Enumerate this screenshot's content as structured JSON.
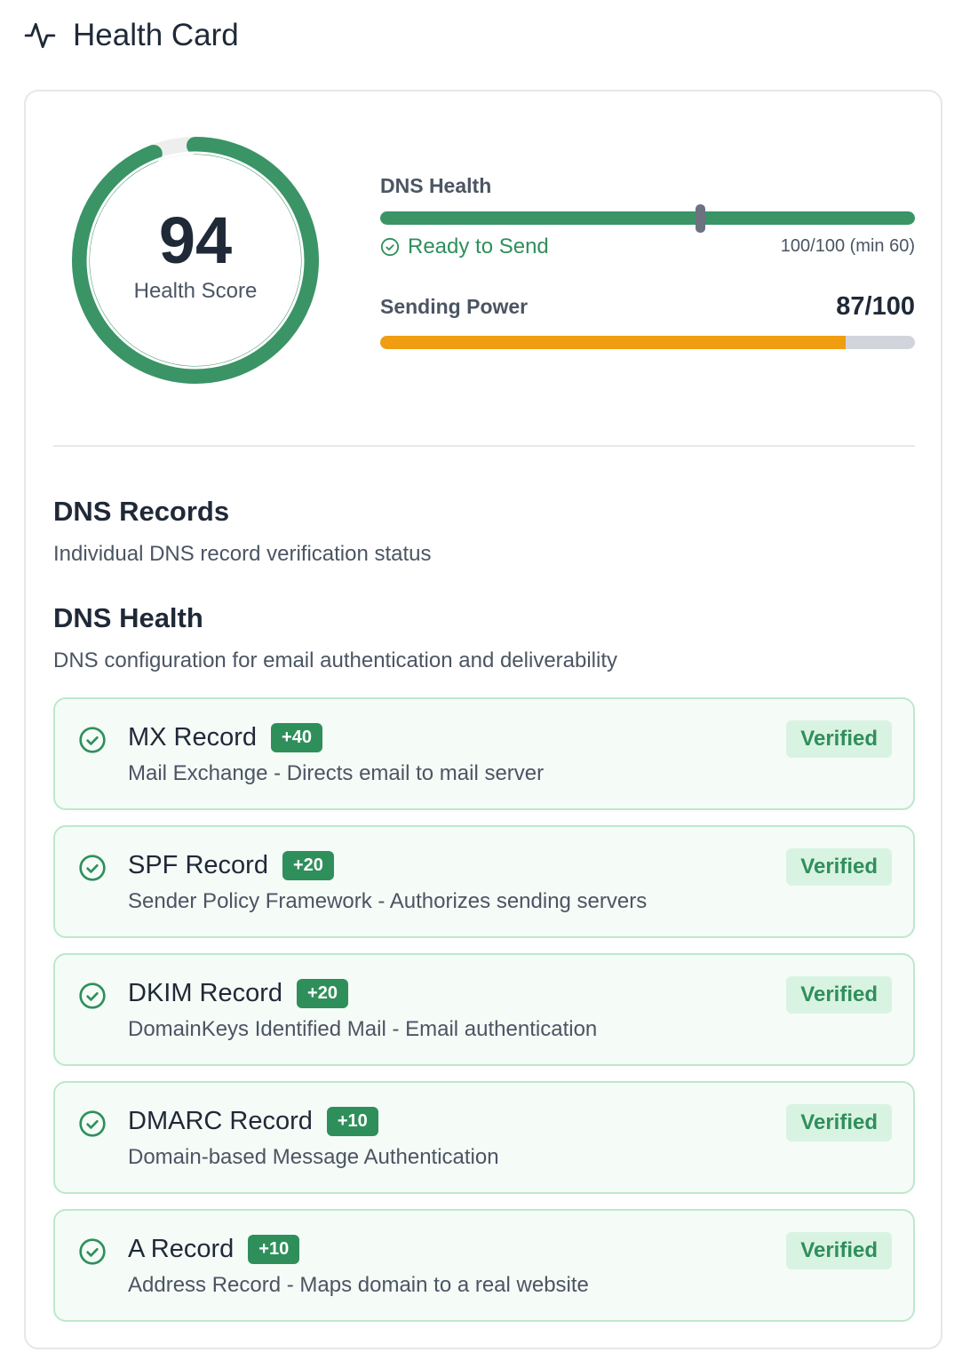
{
  "header": {
    "title": "Health Card",
    "icon": "activity-icon"
  },
  "score": {
    "value": "94",
    "label": "Health Score",
    "fraction": 0.94
  },
  "dns_health": {
    "label": "DNS Health",
    "value": 100,
    "max": 100,
    "min": 60,
    "status": "Ready to Send",
    "detail": "100/100 (min 60)"
  },
  "sending_power": {
    "label": "Sending Power",
    "value_text": "87/100",
    "value": 87,
    "max": 100
  },
  "dns_records": {
    "title": "DNS Records",
    "subtitle": "Individual DNS record verification status"
  },
  "dns_config": {
    "title": "DNS Health",
    "subtitle": "DNS configuration for email authentication and deliverability"
  },
  "records": [
    {
      "name": "MX Record",
      "points": "+40",
      "description": "Mail Exchange - Directs email to mail server",
      "status": "Verified"
    },
    {
      "name": "SPF Record",
      "points": "+20",
      "description": "Sender Policy Framework - Authorizes sending servers",
      "status": "Verified"
    },
    {
      "name": "DKIM Record",
      "points": "+20",
      "description": "DomainKeys Identified Mail - Email authentication",
      "status": "Verified"
    },
    {
      "name": "DMARC Record",
      "points": "+10",
      "description": "Domain-based Message Authentication",
      "status": "Verified"
    },
    {
      "name": "A Record",
      "points": "+10",
      "description": "Address Record - Maps domain to a real website",
      "status": "Verified"
    }
  ],
  "colors": {
    "green": "#3a9466",
    "orange": "#f09d11",
    "track": "#eeeeee"
  }
}
